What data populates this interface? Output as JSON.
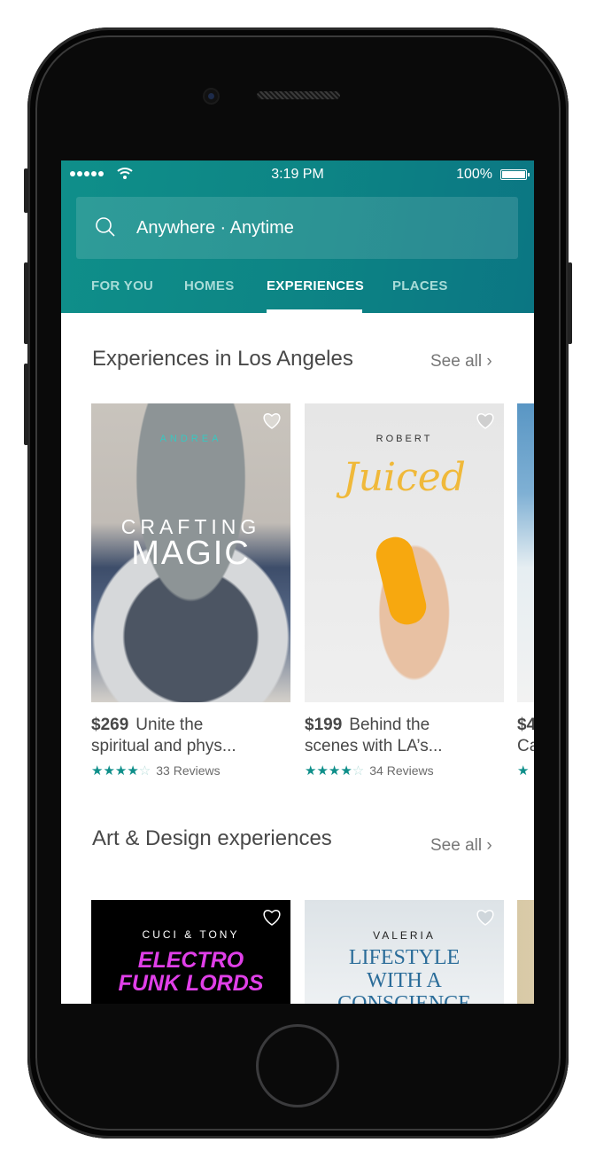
{
  "status_bar": {
    "time": "3:19 PM",
    "battery": "100%",
    "signal_icon": "signal-dots-icon",
    "wifi_icon": "wifi-icon"
  },
  "search": {
    "icon": "search-icon",
    "value": "Anywhere · Anytime"
  },
  "tabs": [
    {
      "label": "FOR YOU",
      "active": false
    },
    {
      "label": "HOMES",
      "active": false
    },
    {
      "label": "EXPERIENCES",
      "active": true
    },
    {
      "label": "PLACES",
      "active": false
    }
  ],
  "colors": {
    "brand_teal": "#0f8f8a",
    "tab_inactive": "#a9dcd8",
    "text_dark": "#484848",
    "text_muted": "#767676"
  },
  "sections": [
    {
      "title": "Experiences in Los Angeles",
      "see_all": "See all",
      "cards": [
        {
          "host": "ANDREA",
          "image_title_1": "CRAFTING",
          "image_title_2": "MAGIC",
          "price": "$269",
          "desc_1": "Unite the",
          "desc_2": "spiritual and phys...",
          "rating": 4,
          "reviews": "33 Reviews"
        },
        {
          "host": "ROBERT",
          "image_title_1": "Juiced",
          "price": "$199",
          "desc_1": "Behind the",
          "desc_2": "scenes with LA’s...",
          "rating": 4,
          "reviews": "34 Reviews"
        },
        {
          "price": "$4",
          "desc_2": "Ca",
          "rating": 1
        }
      ]
    },
    {
      "title": "Art & Design experiences",
      "see_all": "See all",
      "cards": [
        {
          "host": "CUCI & TONY",
          "image_title_1": "ELECTRO",
          "image_title_2": "FUNK LORDS"
        },
        {
          "host": "VALERIA",
          "image_title_1": "LIFESTYLE",
          "image_title_2": "WITH A",
          "image_title_3": "CONSCIENCE"
        }
      ]
    }
  ]
}
